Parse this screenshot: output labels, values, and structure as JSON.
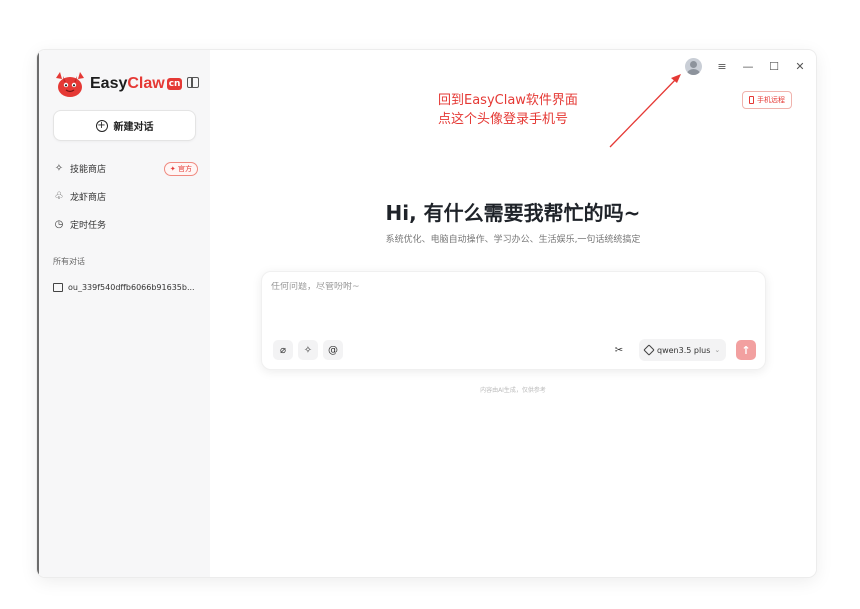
{
  "app": {
    "logo_easy": "Easy",
    "logo_claw": "Claw",
    "logo_badge": "cn"
  },
  "sidebar": {
    "new_chat_label": "新建对话",
    "items": [
      {
        "icon": "sparkle-icon",
        "glyph": "✧",
        "label": "技能商店",
        "tag": "官方"
      },
      {
        "icon": "shrimp-icon",
        "glyph": "♧",
        "label": "龙虾商店"
      },
      {
        "icon": "clock-icon",
        "glyph": "◷",
        "label": "定时任务"
      }
    ],
    "section_label": "所有对话",
    "conversations": [
      {
        "label": "ou_339f540dffb6066b91635b..."
      }
    ]
  },
  "header": {
    "phone_remote_label": "手机远程"
  },
  "annotation": {
    "line1": "回到EasyClaw软件界面",
    "line2": "点这个头像登录手机号",
    "color": "#e53935"
  },
  "main": {
    "greeting": "Hi, 有什么需要我帮忙的吗~",
    "subgreeting": "系统优化、电脑自动操作、学习办公、生活娱乐,一句话统统搞定",
    "composer": {
      "placeholder": "任何问题，尽管吩咐~",
      "value": "",
      "model": "qwen3.5 plus"
    },
    "footnote": "内容由AI生成，仅供参考"
  },
  "colors": {
    "accent": "#e53935",
    "send_disabled": "#f2a0a0",
    "sidebar_bg": "#f7f7f8"
  }
}
